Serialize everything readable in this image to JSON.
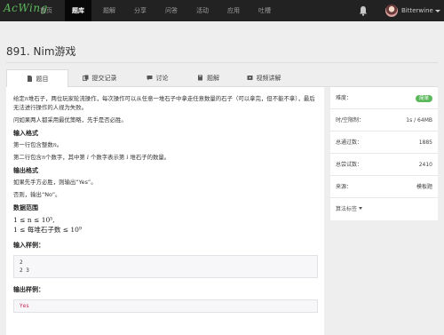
{
  "nav": {
    "logo": "AcWing",
    "items": [
      "首页",
      "题库",
      "题解",
      "分享",
      "问答",
      "活动",
      "应用",
      "吐槽"
    ],
    "active_index": 1,
    "username": "Bitterwine"
  },
  "problem": {
    "title": "891. Nim游戏"
  },
  "tabs": [
    {
      "label": "题目",
      "icon": "file-icon"
    },
    {
      "label": "提交记录",
      "icon": "copy-icon"
    },
    {
      "label": "讨论",
      "icon": "comment-icon"
    },
    {
      "label": "题解",
      "icon": "book-icon"
    },
    {
      "label": "视频讲解",
      "icon": "video-icon"
    }
  ],
  "content": {
    "desc1a": "给定",
    "desc1_var": "n",
    "desc1b": "堆石子，两位玩家轮流操作，每次操作可以从任意一堆石子中拿走任意数量的石子（可以拿完，但不能不拿），最后无法进行操作的人视为失败。",
    "desc2": "问如果两人都采用最优策略，先手是否必胜。",
    "input_heading": "输入格式",
    "input1a": "第一行包含整数",
    "input1_var": "n",
    "input1b": "。",
    "input2a": "第二行包含",
    "input2_var": "n",
    "input2b": "个数字，其中第",
    "input2_var2": "i",
    "input2c": "个数字表示第",
    "input2_var3": "i",
    "input2d": "堆石子的数量。",
    "output_heading": "输出格式",
    "output1": "如果先手方必胜，则输出“Yes”。",
    "output2": "否则，输出“No”。",
    "range_heading": "数据范围",
    "range1": "1 ≤ n ≤ 10⁵,",
    "range2": "1 ≤ 每堆石子数 ≤ 10⁹",
    "sample_in_heading": "输入样例：",
    "sample_in": "2\n2 3",
    "sample_out_heading": "输出样例：",
    "sample_out": "Yes"
  },
  "sidebar": {
    "difficulty_label": "难度：",
    "difficulty_value": "简单",
    "limit_label": "时/空限制：",
    "limit_value": "1s / 64MB",
    "passed_label": "总通过数：",
    "passed_value": "1885",
    "tries_label": "总尝试数：",
    "tries_value": "2410",
    "source_label": "来源：",
    "source_value": "模板题",
    "tags_label": "算法标签"
  },
  "colors": {
    "navbar": "#222222",
    "logo": "#5cb85c",
    "badge": "#5cb85c",
    "sample_output": "#c7254e"
  }
}
